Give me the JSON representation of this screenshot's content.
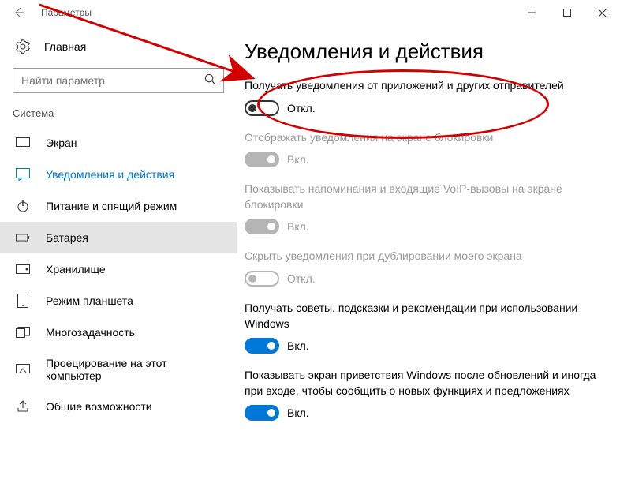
{
  "window": {
    "title": "Параметры"
  },
  "sidebar": {
    "home": "Главная",
    "search_placeholder": "Найти параметр",
    "section": "Система",
    "items": [
      {
        "label": "Экран"
      },
      {
        "label": "Уведомления и действия"
      },
      {
        "label": "Питание и спящий режим"
      },
      {
        "label": "Батарея"
      },
      {
        "label": "Хранилище"
      },
      {
        "label": "Режим планшета"
      },
      {
        "label": "Многозадачность"
      },
      {
        "label": "Проецирование на этот компьютер"
      },
      {
        "label": "Общие возможности"
      }
    ]
  },
  "page": {
    "heading": "Уведомления и действия",
    "settings": [
      {
        "label": "Получать уведомления от приложений и других отправителей",
        "state": "Откл.",
        "on": false,
        "disabled": false
      },
      {
        "label": "Отображать уведомления на экране блокировки",
        "state": "Вкл.",
        "on": true,
        "disabled": true
      },
      {
        "label": "Показывать напоминания и входящие VoIP-вызовы на экране блокировки",
        "state": "Вкл.",
        "on": true,
        "disabled": true
      },
      {
        "label": "Скрыть уведомления при дублировании моего экрана",
        "state": "Откл.",
        "on": false,
        "disabled": true
      },
      {
        "label": "Получать советы, подсказки и рекомендации при использовании Windows",
        "state": "Вкл.",
        "on": true,
        "disabled": false
      },
      {
        "label": "Показывать экран приветствия Windows после обновлений и иногда при входе, чтобы сообщить о новых функциях и предложениях",
        "state": "Вкл.",
        "on": true,
        "disabled": false
      }
    ]
  },
  "annotation": {
    "color": "#d40000"
  }
}
